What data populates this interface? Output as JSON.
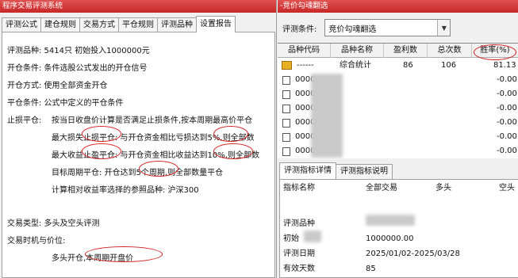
{
  "left_window": {
    "title": "程序交易评测系统",
    "tabs": [
      "评测公式",
      "建仓规则",
      "交易方式",
      "平仓规则",
      "评测品种",
      "设置报告"
    ],
    "active_tab": 5,
    "report": {
      "line_variety": "评测品种:   5414只 初始投入1000000元",
      "line_open_cond": "开仓条件:   条件选股公式发出的开仓信号",
      "line_open_mode": "开仓方式:   使用全部资金开仓",
      "line_close_cond": "平仓条件:   公式中定义的平仓条件",
      "stop_label": "止损平仓:",
      "stop_desc": "按当日收盘价计算是否满足止损条件,按本周期最高价平仓",
      "max_loss": "最大损失止损平仓:  与开仓资金相比亏损达到5%,则全部数",
      "max_profit": "最大收益止盈平仓:  与开仓资金相比收益达到10%,则全部数",
      "target_period": "目标周期平仓:  开仓达到5个周期,则全部数量平仓",
      "benchmark": "计算相对收益率选择的参照品种:  沪深300",
      "trade_type": "交易类型:   多头及空头评测",
      "trade_timing": "交易时机与价位:",
      "timing_detail": "多头开仓,本周期开盘价"
    }
  },
  "right_window": {
    "title": "-竞价勾魂翻选",
    "condition_label": "评测条件:",
    "condition_value": "竞价勾魂翻选",
    "columns": [
      "品种代码",
      "品种名称",
      "盈利数",
      "总次数",
      "胜率(%)"
    ],
    "summary_row": {
      "code": "------",
      "name": "综合统计",
      "profit": "86",
      "total": "106",
      "rate": "81.13"
    },
    "rows": [
      {
        "code": "0000",
        "rate": "-0.00"
      },
      {
        "code": "0000",
        "rate": "-0.00"
      },
      {
        "code": "0000",
        "rate": "-0.00"
      },
      {
        "code": "0000",
        "rate": "-0.00"
      },
      {
        "code": "0000",
        "rate": "-0.00"
      },
      {
        "code": "0000",
        "rate": "-0.00"
      }
    ],
    "bottom_tabs": [
      "评测指标详情",
      "评测指标说明"
    ],
    "detail_headers": [
      "指标名称",
      "全部交易",
      "多头",
      "空头"
    ],
    "detail_rows": [
      {
        "name": "评测品种",
        "value": ""
      },
      {
        "name": "初始",
        "value": "1000000.00"
      },
      {
        "name": "评测日期",
        "value": "2025/01/02-2025/03/28"
      },
      {
        "name": "有效天数",
        "value": "85"
      }
    ]
  },
  "colors": {
    "title_bar": "#c82828",
    "annotation": "#d42020",
    "summary_icon": "#e8b020"
  }
}
